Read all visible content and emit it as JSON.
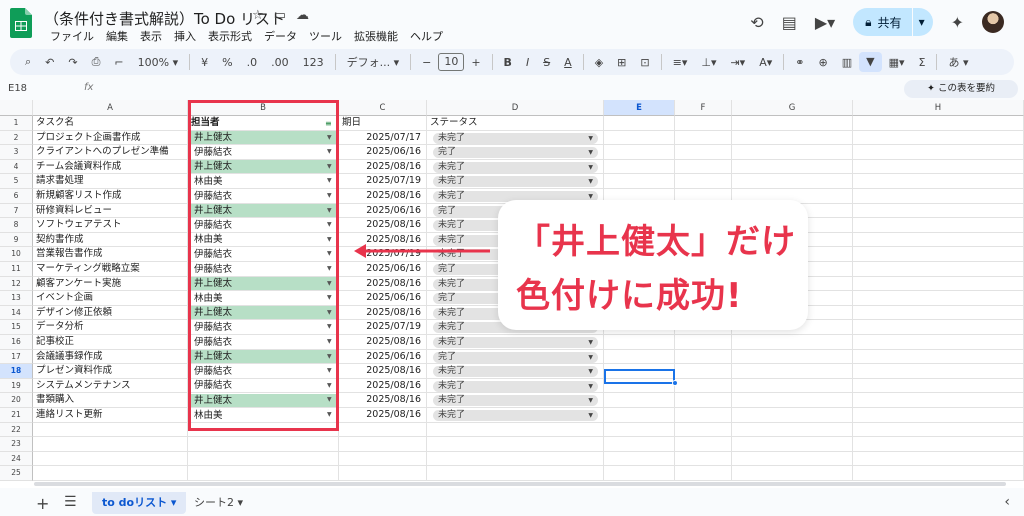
{
  "app": {
    "title": "（条件付き書式解説）To Do リスト"
  },
  "menu": [
    "ファイル",
    "編集",
    "表示",
    "挿入",
    "表示形式",
    "データ",
    "ツール",
    "拡張機能",
    "ヘルプ"
  ],
  "share_label": "共有",
  "toolbar": {
    "zoom": "100%",
    "currency": "¥",
    "percent": "%",
    "dec_decrease": ".0",
    "dec_increase": ".00",
    "number_format": "123",
    "font": "デフォ...",
    "font_size": "10",
    "minus": "−",
    "plus": "+",
    "bold": "B",
    "italic": "I",
    "strike": "S",
    "underline_a": "A",
    "input_tools": "あ"
  },
  "formula_bar": {
    "cell_ref": "E18",
    "fx": "fx",
    "summarize": "✦ この表を要約"
  },
  "columns": [
    "A",
    "B",
    "C",
    "D",
    "E",
    "F",
    "G",
    "H"
  ],
  "row_numbers": [
    "1",
    "2",
    "3",
    "4",
    "5",
    "6",
    "7",
    "8",
    "9",
    "10",
    "11",
    "12",
    "13",
    "14",
    "15",
    "16",
    "17",
    "18",
    "19",
    "20",
    "21",
    "22",
    "23",
    "24",
    "25"
  ],
  "headers": {
    "task": "タスク名",
    "owner": "担当者",
    "due": "期日",
    "status": "ステータス"
  },
  "rows": [
    {
      "task": "プロジェクト企画書作成",
      "owner": "井上健太",
      "due": "2025/07/17",
      "status": "未完了"
    },
    {
      "task": "クライアントへのプレゼン準備",
      "owner": "伊藤結衣",
      "due": "2025/06/16",
      "status": "完了"
    },
    {
      "task": "チーム会議資料作成",
      "owner": "井上健太",
      "due": "2025/08/16",
      "status": "未完了"
    },
    {
      "task": "請求書処理",
      "owner": "林由美",
      "due": "2025/07/19",
      "status": "未完了"
    },
    {
      "task": "新規顧客リスト作成",
      "owner": "伊藤結衣",
      "due": "2025/08/16",
      "status": "未完了"
    },
    {
      "task": "研修資料レビュー",
      "owner": "井上健太",
      "due": "2025/06/16",
      "status": "完了"
    },
    {
      "task": "ソフトウェアテスト",
      "owner": "伊藤結衣",
      "due": "2025/08/16",
      "status": "未完了"
    },
    {
      "task": "契約書作成",
      "owner": "林由美",
      "due": "2025/08/16",
      "status": "未完了"
    },
    {
      "task": "営業報告書作成",
      "owner": "伊藤結衣",
      "due": "2025/07/19",
      "status": "未完了"
    },
    {
      "task": "マーケティング戦略立案",
      "owner": "伊藤結衣",
      "due": "2025/06/16",
      "status": "完了"
    },
    {
      "task": "顧客アンケート実施",
      "owner": "井上健太",
      "due": "2025/08/16",
      "status": "未完了"
    },
    {
      "task": "イベント企画",
      "owner": "林由美",
      "due": "2025/06/16",
      "status": "完了"
    },
    {
      "task": "デザイン修正依頼",
      "owner": "井上健太",
      "due": "2025/08/16",
      "status": "未完了"
    },
    {
      "task": "データ分析",
      "owner": "伊藤結衣",
      "due": "2025/07/19",
      "status": "未完了"
    },
    {
      "task": "記事校正",
      "owner": "伊藤結衣",
      "due": "2025/08/16",
      "status": "未完了"
    },
    {
      "task": "会議議事録作成",
      "owner": "井上健太",
      "due": "2025/06/16",
      "status": "完了"
    },
    {
      "task": "プレゼン資料作成",
      "owner": "伊藤結衣",
      "due": "2025/08/16",
      "status": "未完了"
    },
    {
      "task": "システムメンテナンス",
      "owner": "伊藤結衣",
      "due": "2025/08/16",
      "status": "未完了"
    },
    {
      "task": "書類購入",
      "owner": "井上健太",
      "due": "2025/08/16",
      "status": "未完了"
    },
    {
      "task": "連絡リスト更新",
      "owner": "林由美",
      "due": "2025/08/16",
      "status": "未完了"
    }
  ],
  "highlight_owner": "井上健太",
  "colors": {
    "highlight": "#b7dfc6",
    "accent_red": "#e8344c",
    "selection": "#1a73e8"
  },
  "callout": {
    "line1": "「井上健太」だけ",
    "line2": "色付けに成功!"
  },
  "sheets": {
    "active": "to doリスト",
    "other": "シート2"
  }
}
